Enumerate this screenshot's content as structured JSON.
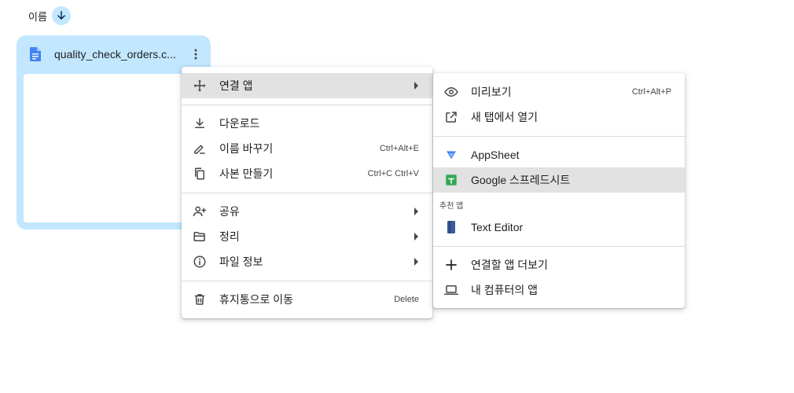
{
  "sort_header": {
    "label": "이름",
    "icon": "arrow-down-icon"
  },
  "file_card": {
    "title": "quality_check_orders.c...",
    "file_icon": "google-doc-icon",
    "more_icon": "more-vert-icon"
  },
  "context_menu": {
    "open_with": {
      "label": "연결 앱",
      "icon": "open-with-icon"
    },
    "download": {
      "label": "다운로드",
      "icon": "download-icon"
    },
    "rename": {
      "label": "이름 바꾸기",
      "shortcut": "Ctrl+Alt+E",
      "icon": "rename-icon"
    },
    "copy": {
      "label": "사본 만들기",
      "shortcut": "Ctrl+C Ctrl+V",
      "icon": "copy-icon"
    },
    "share": {
      "label": "공유",
      "icon": "person-add-icon"
    },
    "organize": {
      "label": "정리",
      "icon": "folder-open-icon"
    },
    "file_info": {
      "label": "파일 정보",
      "icon": "info-icon"
    },
    "trash": {
      "label": "휴지통으로 이동",
      "shortcut": "Delete",
      "icon": "trash-icon"
    }
  },
  "open_with_menu": {
    "preview": {
      "label": "미리보기",
      "shortcut": "Ctrl+Alt+P",
      "icon": "eye-icon"
    },
    "new_tab": {
      "label": "새 탭에서 열기",
      "icon": "open-in-new-icon"
    },
    "appsheet": {
      "label": "AppSheet",
      "icon": "appsheet-icon"
    },
    "sheets": {
      "label": "Google 스프레드시트",
      "icon": "google-sheets-icon"
    },
    "suggested_heading": "추천 앱",
    "text_editor": {
      "label": "Text Editor",
      "icon": "text-editor-icon"
    },
    "more_apps": {
      "label": "연결할 앱 더보기",
      "icon": "plus-icon"
    },
    "computer_apps": {
      "label": "내 컴퓨터의 앱",
      "icon": "laptop-icon"
    }
  },
  "colors": {
    "accent": "#c2e7ff",
    "doc_blue": "#4285f4",
    "sheets_green": "#34a853",
    "highlight": "#e2e2e2"
  }
}
